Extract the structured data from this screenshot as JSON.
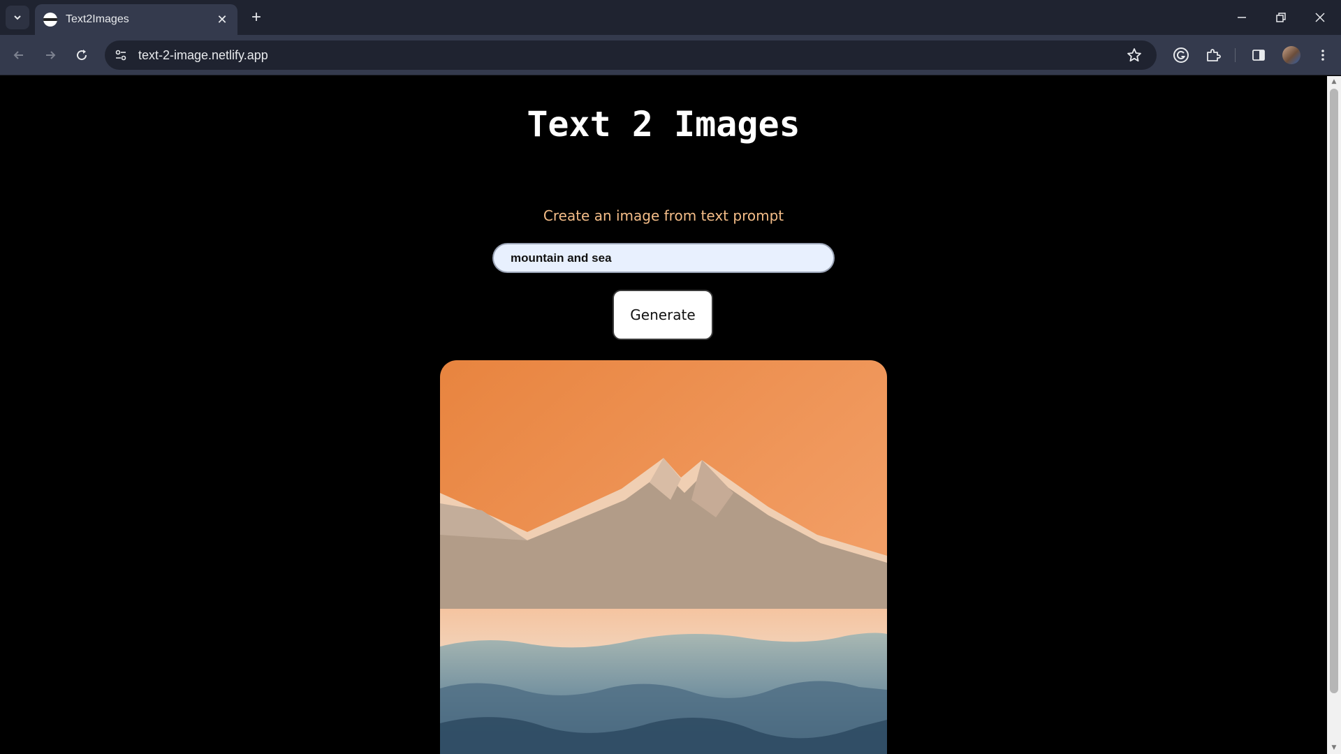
{
  "browser": {
    "tab_title": "Text2Images",
    "url": "text-2-image.netlify.app",
    "icons": {
      "tab_search": "chevron-down-icon",
      "close_tab": "close-icon",
      "new_tab": "plus-icon",
      "minimize": "minimize-icon",
      "restore": "restore-icon",
      "close_window": "close-icon",
      "back": "back-arrow-icon",
      "forward": "forward-arrow-icon",
      "reload": "reload-icon",
      "site_info": "site-info-icon",
      "bookmark": "star-icon",
      "grammarly": "grammarly-icon",
      "extensions": "puzzle-icon",
      "side_panel": "side-panel-icon",
      "profile": "avatar",
      "menu": "kebab-menu-icon"
    }
  },
  "page": {
    "title": "Text 2 Images",
    "subtitle": "Create an image from text prompt",
    "prompt_value": "mountain and sea",
    "generate_label": "Generate",
    "image_subject": "mountain-and-sea-illustration"
  },
  "colors": {
    "background": "#000000",
    "subtitle": "#f4bd88",
    "input_bg": "#e8f0fe",
    "sky": "#ee8f4e",
    "chrome_dark": "#1f2330",
    "chrome_light": "#343a4d"
  }
}
